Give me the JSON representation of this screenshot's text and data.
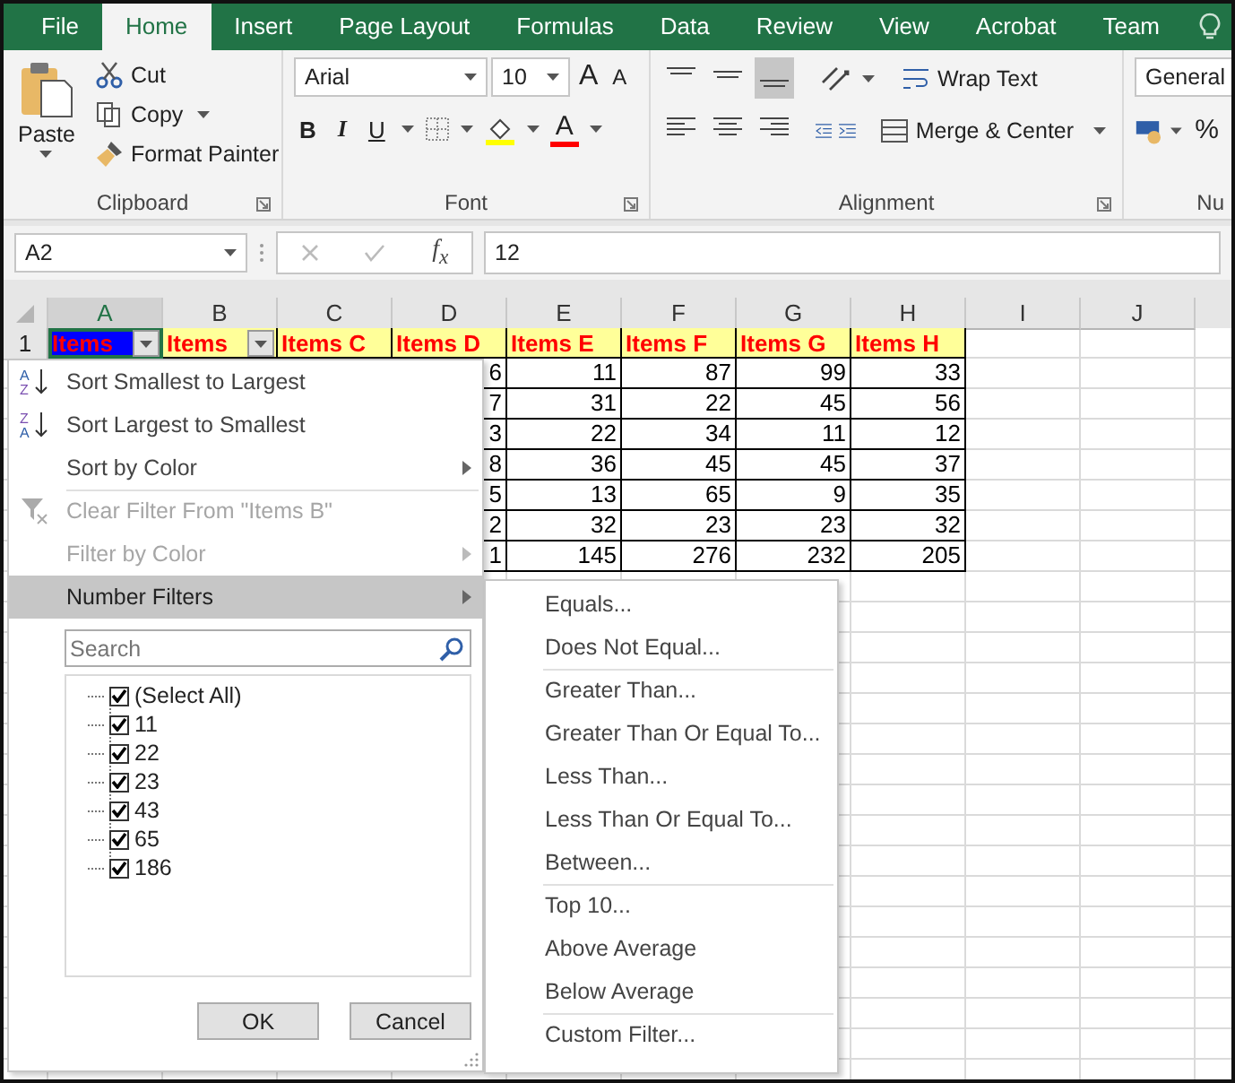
{
  "tabs": [
    {
      "label": "File",
      "selected": false
    },
    {
      "label": "Home",
      "selected": true
    },
    {
      "label": "Insert",
      "selected": false
    },
    {
      "label": "Page Layout",
      "selected": false
    },
    {
      "label": "Formulas",
      "selected": false
    },
    {
      "label": "Data",
      "selected": false
    },
    {
      "label": "Review",
      "selected": false
    },
    {
      "label": "View",
      "selected": false
    },
    {
      "label": "Acrobat",
      "selected": false
    },
    {
      "label": "Team",
      "selected": false
    }
  ],
  "ribbon": {
    "clipboard": {
      "paste": "Paste",
      "cut": "Cut",
      "copy": "Copy",
      "format_painter": "Format Painter",
      "label": "Clipboard"
    },
    "font": {
      "font_name": "Arial",
      "font_size": "10",
      "grow": "A",
      "shrink": "A",
      "bold": "B",
      "italic": "I",
      "underline": "U",
      "font_color": "A",
      "label": "Font"
    },
    "alignment": {
      "wrap_text": "Wrap Text",
      "merge_center": "Merge & Center",
      "label": "Alignment"
    },
    "number": {
      "format": "General",
      "percent": "%",
      "label": "Nu"
    }
  },
  "formula_bar": {
    "name_box": "A2",
    "fx": "f$_{x}$",
    "value": "12"
  },
  "sheet": {
    "columns": [
      {
        "label": "A",
        "selected": true
      },
      {
        "label": "B",
        "selected": false
      },
      {
        "label": "C",
        "selected": false
      },
      {
        "label": "D",
        "selected": false
      },
      {
        "label": "E",
        "selected": false
      },
      {
        "label": "F",
        "selected": false
      },
      {
        "label": "G",
        "selected": false
      },
      {
        "label": "H",
        "selected": false
      },
      {
        "label": "I",
        "selected": false
      },
      {
        "label": "J",
        "selected": false
      }
    ],
    "header_row": {
      "number": "1",
      "cells": [
        {
          "text": "Items",
          "selected": true,
          "filter": true
        },
        {
          "text": "Items",
          "selected": false,
          "filter": true
        },
        {
          "text": "Items C",
          "selected": false,
          "filter": false
        },
        {
          "text": "Items D",
          "selected": false,
          "filter": false
        },
        {
          "text": "Items E",
          "selected": false,
          "filter": false
        },
        {
          "text": "Items F",
          "selected": false,
          "filter": false
        },
        {
          "text": "Items G",
          "selected": false,
          "filter": false
        },
        {
          "text": "Items H",
          "selected": false,
          "filter": false
        }
      ]
    },
    "rows": [
      {
        "cells": [
          "6",
          "11",
          "87",
          "99",
          "33"
        ]
      },
      {
        "cells": [
          "7",
          "31",
          "22",
          "45",
          "56"
        ]
      },
      {
        "cells": [
          "3",
          "22",
          "34",
          "11",
          "12"
        ]
      },
      {
        "cells": [
          "8",
          "36",
          "45",
          "45",
          "37"
        ]
      },
      {
        "cells": [
          "5",
          "13",
          "65",
          "9",
          "35"
        ]
      },
      {
        "cells": [
          "2",
          "32",
          "23",
          "23",
          "32"
        ]
      },
      {
        "cells": [
          "1",
          "145",
          "276",
          "232",
          "205"
        ]
      }
    ]
  },
  "filter_menu": {
    "items": [
      {
        "label": "Sort Smallest to Largest",
        "kind": "sort_asc",
        "icon_letters": [
          "A",
          "Z"
        ],
        "disabled": false,
        "submenu": false,
        "selected": false,
        "separator_before": false
      },
      {
        "label": "Sort Largest to Smallest",
        "kind": "sort_desc",
        "icon_letters": [
          "Z",
          "A"
        ],
        "disabled": false,
        "submenu": false,
        "selected": false,
        "separator_before": false
      },
      {
        "label": "Sort by Color",
        "kind": "plain",
        "disabled": false,
        "submenu": true,
        "selected": false,
        "separator_before": false
      },
      {
        "label": "Clear Filter From \"Items B\"",
        "kind": "clear_filter",
        "disabled": true,
        "submenu": false,
        "selected": false,
        "separator_before": true
      },
      {
        "label": "Filter by Color",
        "kind": "plain",
        "disabled": true,
        "submenu": true,
        "selected": false,
        "separator_before": false
      },
      {
        "label": "Number Filters",
        "kind": "plain",
        "disabled": false,
        "submenu": true,
        "selected": true,
        "separator_before": false
      }
    ],
    "search": {
      "placeholder": "Search"
    },
    "values": [
      {
        "label": "(Select All)",
        "checked": true
      },
      {
        "label": "11",
        "checked": true
      },
      {
        "label": "22",
        "checked": true
      },
      {
        "label": "23",
        "checked": true
      },
      {
        "label": "43",
        "checked": true
      },
      {
        "label": "65",
        "checked": true
      },
      {
        "label": "186",
        "checked": true
      }
    ],
    "buttons": [
      "OK",
      "Cancel"
    ]
  },
  "number_filters_menu": {
    "items": [
      {
        "label": "Equals...",
        "separator_before": false
      },
      {
        "label": "Does Not Equal...",
        "separator_before": false
      },
      {
        "label": "Greater Than...",
        "separator_before": true
      },
      {
        "label": "Greater Than Or Equal To...",
        "separator_before": false
      },
      {
        "label": "Less Than...",
        "separator_before": false
      },
      {
        "label": "Less Than Or Equal To...",
        "separator_before": false
      },
      {
        "label": "Between...",
        "separator_before": false
      },
      {
        "label": "Top 10...",
        "separator_before": true
      },
      {
        "label": "Above Average",
        "separator_before": false
      },
      {
        "label": "Below Average",
        "separator_before": false
      },
      {
        "label": "Custom Filter...",
        "separator_before": true
      }
    ]
  }
}
